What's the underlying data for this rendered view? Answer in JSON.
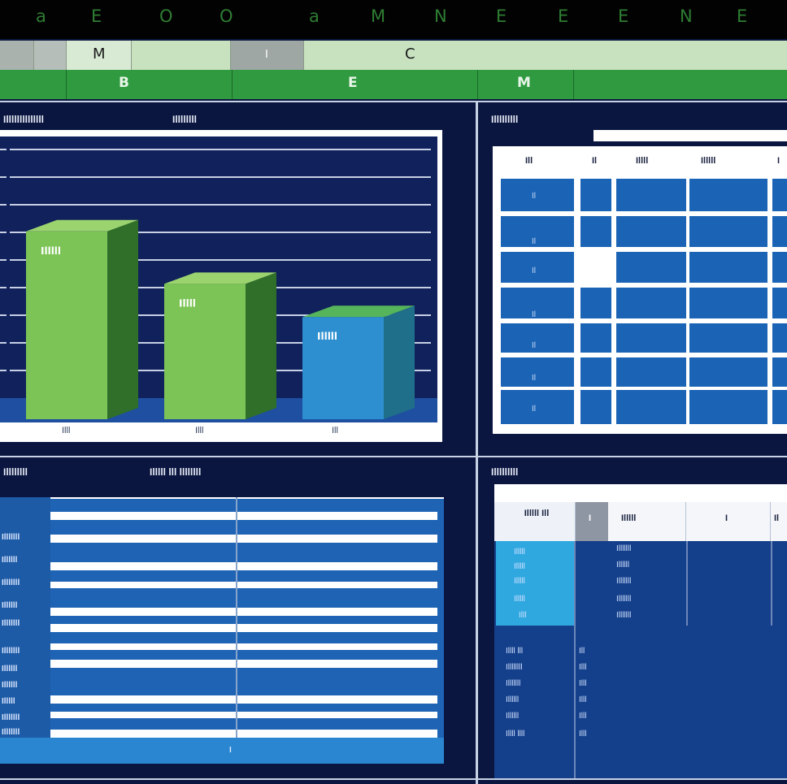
{
  "top_bar": {
    "letters": [
      "a",
      "E",
      "O",
      "O",
      "a",
      "M",
      "N",
      "E",
      "E",
      "E",
      "N",
      "E"
    ]
  },
  "header_row_a": {
    "cells": [
      "M",
      "I",
      "C"
    ]
  },
  "header_row_b": {
    "cells": [
      "B",
      "E",
      "M"
    ]
  },
  "chart_panel": {
    "title_left": "Illllllllllllll",
    "title_right": "Illllllll"
  },
  "chart_data": {
    "type": "bar",
    "categories": [
      "Illl",
      "Illl",
      "Ill"
    ],
    "values": [
      6.8,
      4.9,
      3.7
    ],
    "value_labels": [
      "Illlll",
      "Illll",
      "Illlll"
    ],
    "ylim": [
      0,
      9
    ],
    "grid": true,
    "colors": [
      "#7cc456",
      "#7cc456",
      "#2d8fcf"
    ]
  },
  "table_top_right": {
    "title": "Illlllllll",
    "columns": [
      "Ill",
      "Il",
      "Illll",
      "Illlll",
      "I"
    ],
    "row_markers": [
      "Il",
      "Il",
      "Il",
      "Il",
      "Il",
      "Il",
      "Il"
    ],
    "colors": {
      "cell": "#1a63b5",
      "highlight": "#ffffff"
    }
  },
  "bottom_left_panel": {
    "title_left": "Illllllll",
    "title_right": "Illlll lll llllllll",
    "row_labels": [
      "Illlllll",
      "Illllll",
      "Illlllll",
      "Illllll",
      "Illlllll",
      "Illlllll",
      "Illllll",
      "Illllll",
      "Illlll",
      "Illlllll",
      "Illlllll"
    ],
    "footer_marker": "I"
  },
  "bottom_right_panel": {
    "title": "Illlllllll",
    "columns": [
      "Illlll Ill",
      "I",
      "Illlll",
      "I",
      "Il"
    ],
    "list_a": [
      "Illlll",
      "Illlll",
      "Illlll",
      "Illlll",
      "Illl"
    ],
    "list_b": [
      "Illlllll",
      "Illllll",
      "Illlllll",
      "Illlllll",
      "Illlllll"
    ],
    "list_c": [
      "Illll lll",
      "Illllllll",
      "Illlllll",
      "Illllll",
      "Illllll",
      "Illll llll"
    ],
    "list_d": [
      "Ill",
      "Illl",
      "Illl",
      "Illl",
      "Illl",
      "Illl"
    ]
  }
}
